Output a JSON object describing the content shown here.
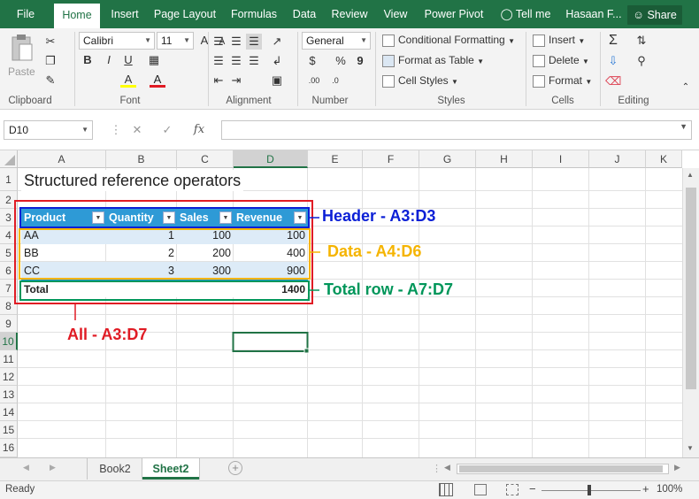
{
  "ribbon_tabs": [
    "File",
    "Home",
    "Insert",
    "Page Layout",
    "Formulas",
    "Data",
    "Review",
    "View",
    "Power Pivot"
  ],
  "tell_me": "Tell me",
  "user_name": "Hasaan F...",
  "share_label": "Share",
  "clipboard": {
    "paste": "Paste",
    "label": "Clipboard"
  },
  "font": {
    "name": "Calibri",
    "size": "11",
    "label": "Font",
    "bold": "B",
    "italic": "I",
    "underline": "U",
    "grow": "A",
    "shrink": "A",
    "highlight": "A",
    "color": "A"
  },
  "alignment": {
    "label": "Alignment"
  },
  "number": {
    "format": "General",
    "currency": "$",
    "percent": "%",
    "comma": "9",
    "label": "Number",
    "inc_decimal": ".00",
    "dec_decimal": ".0"
  },
  "styles": {
    "conditional": "Conditional Formatting",
    "format_table": "Format as Table",
    "cell_styles": "Cell Styles",
    "label": "Styles"
  },
  "cells": {
    "insert": "Insert",
    "delete": "Delete",
    "format": "Format",
    "label": "Cells"
  },
  "editing": {
    "label": "Editing"
  },
  "formula_bar": {
    "name_box": "D10",
    "fx": "fx",
    "content": ""
  },
  "grid": {
    "columns": [
      "A",
      "B",
      "C",
      "D",
      "E",
      "F",
      "G",
      "H",
      "I",
      "J",
      "K"
    ],
    "rows": [
      "1",
      "2",
      "3",
      "4",
      "5",
      "6",
      "7",
      "8",
      "9",
      "10",
      "11",
      "12",
      "13",
      "14",
      "15",
      "16"
    ],
    "title": "Structured reference operators",
    "table_headers": [
      "Product",
      "Quantity",
      "Sales",
      "Revenue"
    ],
    "table_rows": [
      [
        "AA",
        "1",
        "100",
        "100"
      ],
      [
        "BB",
        "2",
        "200",
        "400"
      ],
      [
        "CC",
        "3",
        "300",
        "900"
      ]
    ],
    "total_label": "Total",
    "total_value": "1400"
  },
  "annotations": {
    "header": "Header - A3:D3",
    "data": "Data - A4:D6",
    "total": "Total row - A7:D7",
    "all": "All - A3:D7"
  },
  "annotation_colors": {
    "header": "#0b1fd6",
    "data": "#f5b400",
    "total": "#00965a",
    "all": "#e01b24"
  },
  "sheet_tabs": [
    "Book2",
    "Sheet2"
  ],
  "active_sheet": "Sheet2",
  "status": {
    "ready": "Ready",
    "zoom": "100%",
    "zoom_minus": "−",
    "zoom_plus": "+"
  }
}
